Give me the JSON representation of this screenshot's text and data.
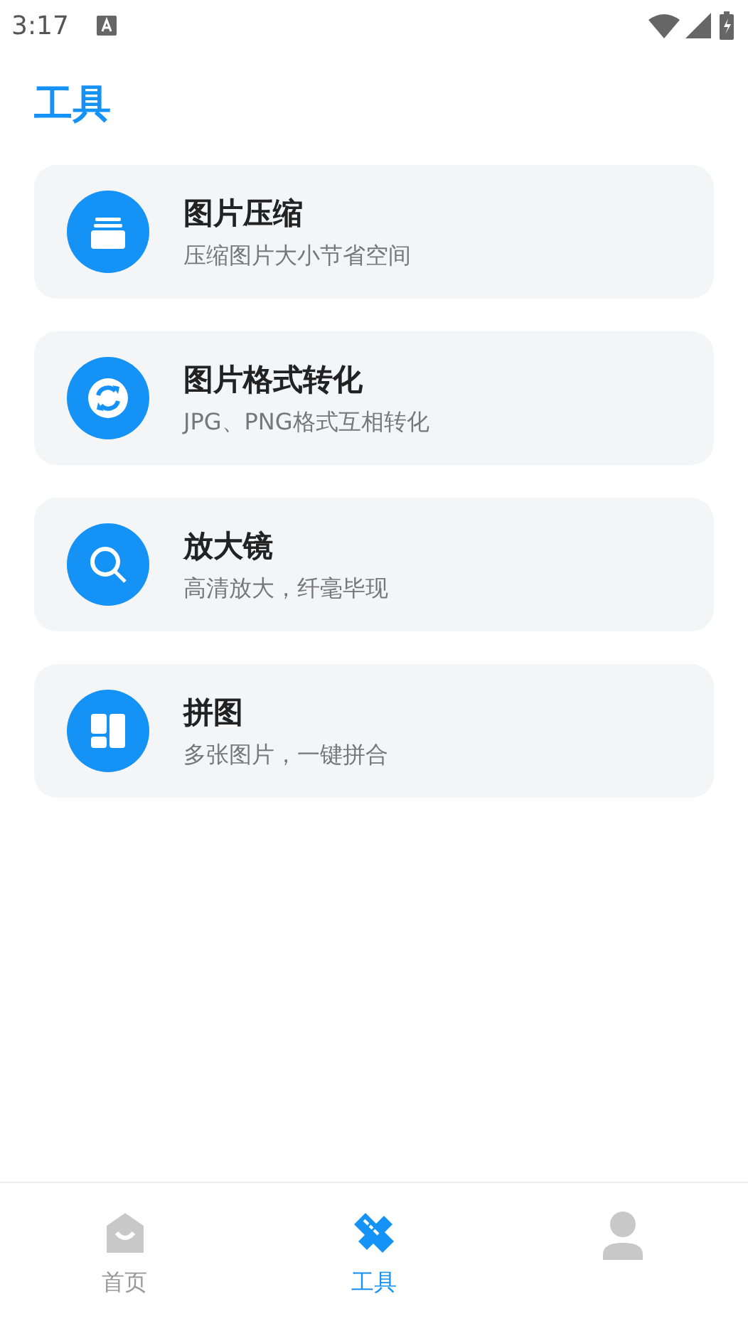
{
  "status_bar": {
    "time": "3:17"
  },
  "title": "工具",
  "tools": [
    {
      "name": "图片压缩",
      "description": "压缩图片大小节省空间"
    },
    {
      "name": "图片格式转化",
      "description": "JPG、PNG格式互相转化"
    },
    {
      "name": "放大镜",
      "description": "高清放大，纤毫毕现"
    },
    {
      "name": "拼图",
      "description": "多张图片，一键拼合"
    }
  ],
  "bottom_nav": [
    {
      "label": "首页",
      "selected": false
    },
    {
      "label": "工具",
      "selected": true
    },
    {
      "selected": false
    }
  ]
}
